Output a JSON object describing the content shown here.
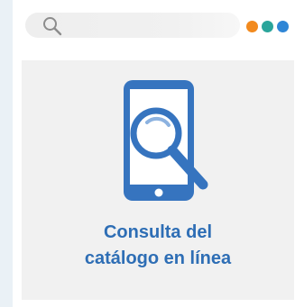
{
  "search": {
    "icon": "search-icon"
  },
  "window_controls": {
    "dots": [
      {
        "name": "orange-dot",
        "color": "#f28a1e"
      },
      {
        "name": "teal-dot",
        "color": "#2aa59b"
      },
      {
        "name": "blue-dot",
        "color": "#2f86d6"
      }
    ]
  },
  "card": {
    "icon": "phone-magnifier-icon",
    "caption_line1": "Consulta del",
    "caption_line2": "catálogo en línea",
    "accent_color": "#2e6eb5",
    "background_color": "#f1f1f1"
  }
}
